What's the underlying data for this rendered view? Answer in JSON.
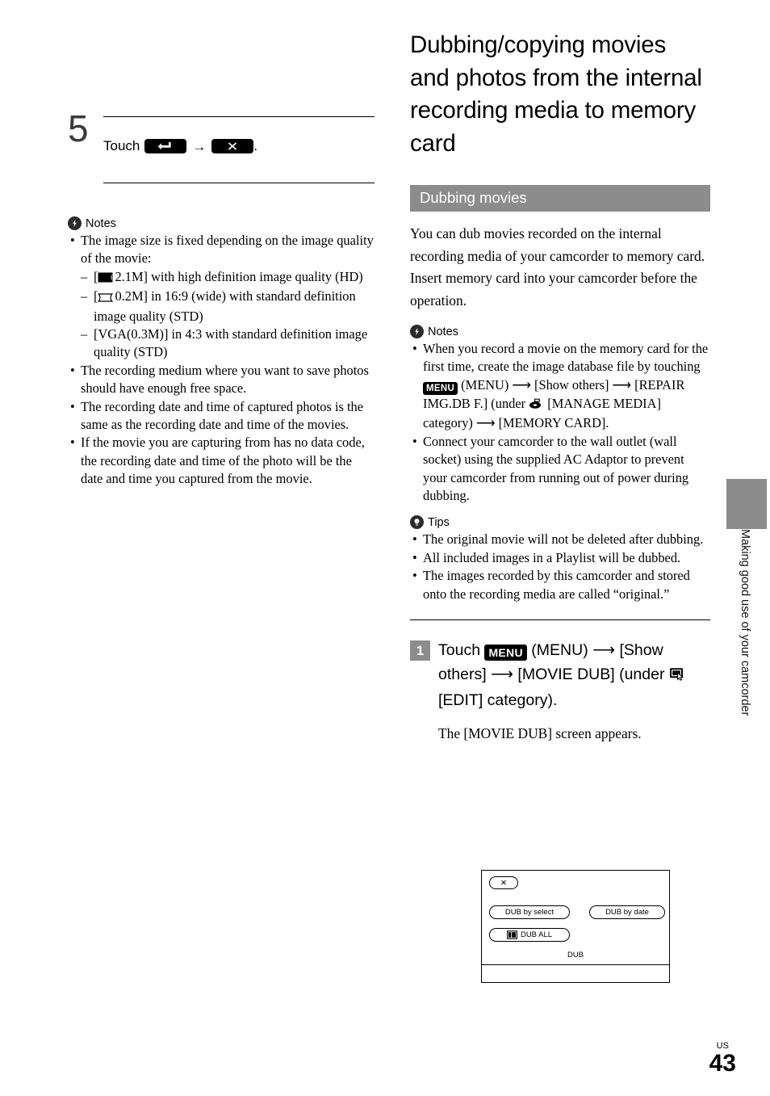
{
  "left_column": {
    "step": {
      "number": "5",
      "text_before": "Touch",
      "key1": "return-key",
      "arrow": "→",
      "key2": "close-key",
      "text_after": "."
    },
    "notes": {
      "heading": "Notes",
      "bullets": [
        {
          "text": "The image size is fixed depending on the image quality of the movie:",
          "sub": [
            {
              "icon": "wide-image-size-filled-icon",
              "text_after": "2.1M] with high definition image quality (HD)",
              "text_before": "["
            },
            {
              "icon": "wide-image-size-outline-icon",
              "text_before": "[",
              "text_after": "0.2M] in 16:9 (wide) with standard definition image quality (STD)"
            },
            {
              "icon": "",
              "text_before": "",
              "text_after": "[VGA(0.3M)] in 4:3 with standard definition image quality (STD)"
            }
          ]
        },
        {
          "text": "The recording medium where you want to save photos should have enough free space.",
          "sub": []
        },
        {
          "text": "The recording date and time of captured photos is the same as the recording date and time of the movies.",
          "sub": []
        },
        {
          "text": "If the movie you are capturing from has no data code, the recording date and time of the photo will be the date and time you captured from the movie.",
          "sub": []
        }
      ]
    }
  },
  "right_column": {
    "title": "Dubbing/copying movies and photos from the internal recording media to memory card",
    "section_bar": "Dubbing movies",
    "intro_paragraphs": [
      "You can dub movies recorded on the internal recording media of your camcorder to memory card.",
      "Insert memory card into your camcorder before the operation."
    ],
    "notes": {
      "heading": "Notes",
      "bullets": [
        {
          "parts": [
            {
              "type": "text",
              "value": "When you record a movie on the memory card for the first time, create the image database file by touching "
            },
            {
              "type": "key",
              "value": "MENU"
            },
            {
              "type": "text",
              "value": " (MENU) ⟶ [Show others] ⟶ [REPAIR IMG.DB F.] (under "
            },
            {
              "type": "icon",
              "value": "manage-media-category-icon"
            },
            {
              "type": "text",
              "value": " [MANAGE MEDIA] category) ⟶ [MEMORY CARD]."
            }
          ]
        },
        {
          "parts": [
            {
              "type": "text",
              "value": "Connect your camcorder to the wall outlet (wall socket) using the supplied AC Adaptor to prevent your camcorder from running out of power during dubbing."
            }
          ]
        }
      ]
    },
    "tips": {
      "heading": "Tips",
      "bullets": [
        "The original movie will not be deleted after dubbing.",
        "All included images in a Playlist will be dubbed.",
        "The images recorded by this camcorder and stored onto the recording media are called “original.”"
      ]
    },
    "procedure": {
      "number": "1",
      "parts": [
        {
          "type": "text",
          "value": "Touch "
        },
        {
          "type": "key",
          "value": "MENU"
        },
        {
          "type": "text",
          "value": " (MENU) ⟶ [Show others] ⟶ [MOVIE DUB] (under "
        },
        {
          "type": "icon",
          "value": "edit-category-icon"
        },
        {
          "type": "text",
          "value": " [EDIT] category)."
        }
      ],
      "result_text": "The [MOVIE DUB] screen appears."
    }
  },
  "lcd_screen": {
    "close_label": "✕",
    "buttons": [
      {
        "label": "DUB by select",
        "icon": ""
      },
      {
        "label": "DUB by date",
        "icon": ""
      },
      {
        "label": "DUB ALL",
        "icon": "dub-all-icon"
      }
    ],
    "footer_label": "DUB"
  },
  "side_tab": {
    "text": "Making good use of your camcorder"
  },
  "folio": {
    "region": "US",
    "number": "43"
  },
  "colors": {
    "section_bar_gray": "#8c8c8c",
    "badge_dark": "#2b2b2b",
    "text_black": "#000000"
  }
}
